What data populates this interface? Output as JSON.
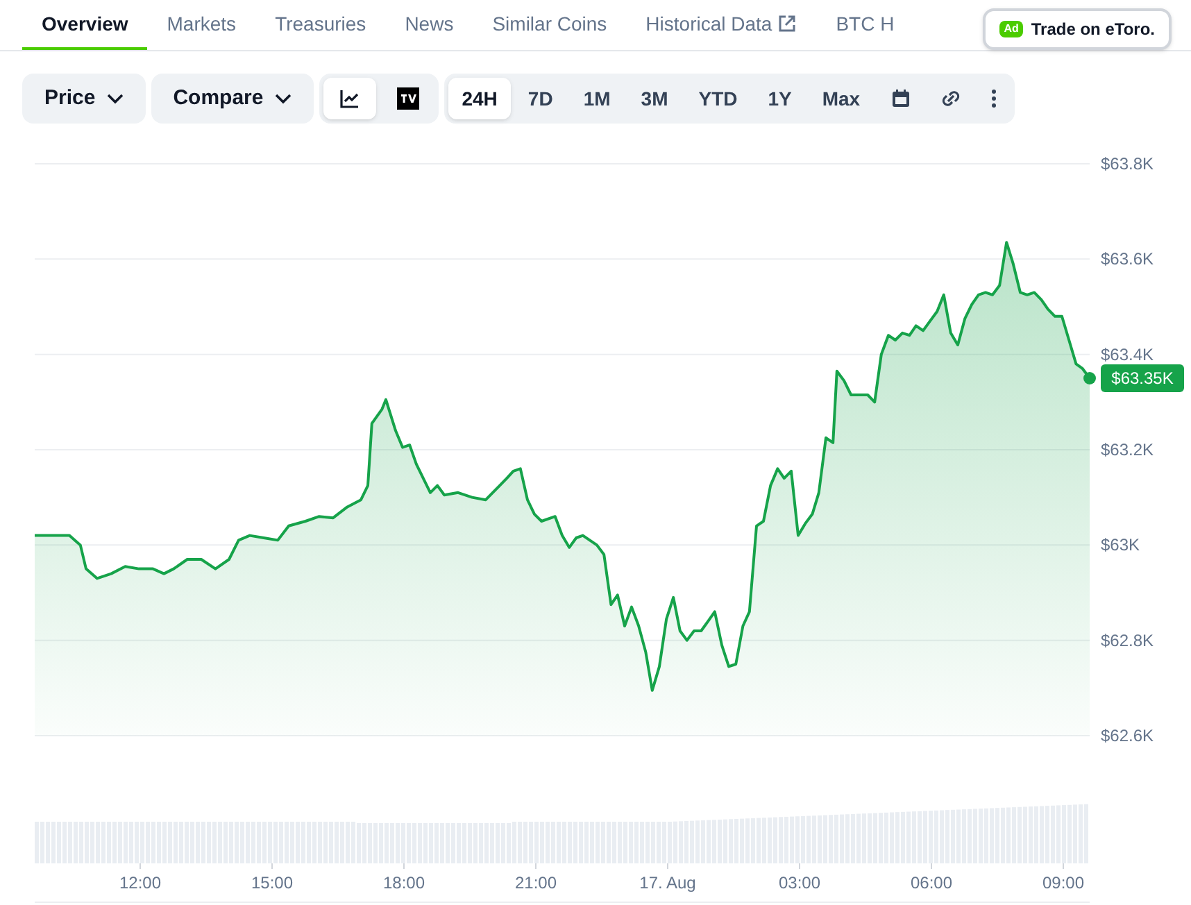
{
  "tabs": [
    {
      "label": "Overview",
      "selected": true,
      "external": false
    },
    {
      "label": "Markets",
      "selected": false,
      "external": false
    },
    {
      "label": "Treasuries",
      "selected": false,
      "external": false
    },
    {
      "label": "News",
      "selected": false,
      "external": false
    },
    {
      "label": "Similar Coins",
      "selected": false,
      "external": false
    },
    {
      "label": "Historical Data",
      "selected": false,
      "external": true
    },
    {
      "label": "BTC H",
      "selected": false,
      "external": false
    }
  ],
  "ad_button": {
    "badge": "Ad",
    "label": "Trade on eToro."
  },
  "toolbar": {
    "dropdowns": [
      "Price",
      "Compare"
    ],
    "chart_types": [
      {
        "kind": "line",
        "selected": true
      },
      {
        "kind": "candles",
        "selected": false
      }
    ],
    "ranges": [
      {
        "label": "24H",
        "selected": true
      },
      {
        "label": "7D",
        "selected": false
      },
      {
        "label": "1M",
        "selected": false
      },
      {
        "label": "3M",
        "selected": false
      },
      {
        "label": "YTD",
        "selected": false
      },
      {
        "label": "1Y",
        "selected": false
      },
      {
        "label": "Max",
        "selected": false
      }
    ]
  },
  "chart": {
    "last_price_label": "$63.35K",
    "next_day_x_labels": [
      "03:00",
      "06:00",
      "09:00"
    ],
    "chart_data": {
      "type": "area",
      "grid": true,
      "xlim": [
        9.6,
        33.6
      ],
      "ylim": [
        62600,
        63800
      ],
      "xticks": [
        {
          "value": 12,
          "label": "12:00"
        },
        {
          "value": 15,
          "label": "15:00"
        },
        {
          "value": 18,
          "label": "18:00"
        },
        {
          "value": 21,
          "label": "21:00"
        },
        {
          "value": 24,
          "label": "17. Aug"
        }
      ],
      "x": [
        9.6,
        9.92,
        10.39,
        10.64,
        10.77,
        11.02,
        11.34,
        11.66,
        11.97,
        12.29,
        12.54,
        12.76,
        13.07,
        13.39,
        13.71,
        14.02,
        14.24,
        14.49,
        14.81,
        15.13,
        15.38,
        15.76,
        16.07,
        16.39,
        16.71,
        17.02,
        17.18,
        17.27,
        17.5,
        17.59,
        17.81,
        17.97,
        18.13,
        18.28,
        18.44,
        18.6,
        18.76,
        18.92,
        19.23,
        19.55,
        19.86,
        20.18,
        20.34,
        20.49,
        20.65,
        20.81,
        20.97,
        21.13,
        21.44,
        21.6,
        21.76,
        21.92,
        22.07,
        22.39,
        22.55,
        22.71,
        22.86,
        23.02,
        23.18,
        23.34,
        23.5,
        23.65,
        23.81,
        23.97,
        24.13,
        24.28,
        24.44,
        24.6,
        24.76,
        24.92,
        25.07,
        25.23,
        25.39,
        25.55,
        25.71,
        25.86,
        26.02,
        26.18,
        26.34,
        26.5,
        26.65,
        26.81,
        26.97,
        27.13,
        27.29,
        27.44,
        27.6,
        27.76,
        27.85,
        28.01,
        28.17,
        28.33,
        28.55,
        28.71,
        28.86,
        29.02,
        29.18,
        29.34,
        29.5,
        29.65,
        29.81,
        29.97,
        30.13,
        30.28,
        30.44,
        30.6,
        30.76,
        30.92,
        31.07,
        31.23,
        31.39,
        31.55,
        31.71,
        31.86,
        32.02,
        32.18,
        32.34,
        32.5,
        32.65,
        32.81,
        32.97,
        33.13,
        33.29,
        33.44,
        33.6
      ],
      "yticks": [
        {
          "value": 62600,
          "label": "$62.6K"
        },
        {
          "value": 62800,
          "label": "$62.8K"
        },
        {
          "value": 63000,
          "label": "$63K"
        },
        {
          "value": 63200,
          "label": "$63.2K"
        },
        {
          "value": 63400,
          "label": "$63.4K"
        },
        {
          "value": 63600,
          "label": "$63.6K"
        },
        {
          "value": 63800,
          "label": "$63.8K"
        }
      ],
      "series": [
        {
          "color": "#16a34a",
          "values": [
            63020,
            63020,
            63020,
            63000,
            62950,
            62930,
            62940,
            62955,
            62950,
            62950,
            62940,
            62950,
            62970,
            62970,
            62950,
            62970,
            63010,
            63020,
            63015,
            63010,
            63040,
            63050,
            63060,
            63057,
            63080,
            63095,
            63125,
            63255,
            63285,
            63305,
            63240,
            63205,
            63210,
            63170,
            63140,
            63110,
            63125,
            63105,
            63110,
            63100,
            63095,
            63125,
            63140,
            63155,
            63160,
            63095,
            63065,
            63050,
            63060,
            63020,
            62995,
            63015,
            63020,
            63000,
            62980,
            62875,
            62895,
            62830,
            62870,
            62830,
            62775,
            62695,
            62745,
            62845,
            62890,
            62820,
            62800,
            62820,
            62820,
            62840,
            62860,
            62790,
            62745,
            62750,
            62830,
            62860,
            63040,
            63050,
            63125,
            63160,
            63140,
            63155,
            63020,
            63045,
            63065,
            63110,
            63225,
            63215,
            63365,
            63345,
            63315,
            63315,
            63315,
            63300,
            63400,
            63440,
            63430,
            63445,
            63440,
            63460,
            63450,
            63470,
            63490,
            63525,
            63445,
            63420,
            63475,
            63505,
            63525,
            63530,
            63525,
            63545,
            63635,
            63590,
            63530,
            63525,
            63530,
            63515,
            63495,
            63480,
            63480,
            63430,
            63380,
            63370,
            63350
          ]
        }
      ]
    }
  }
}
